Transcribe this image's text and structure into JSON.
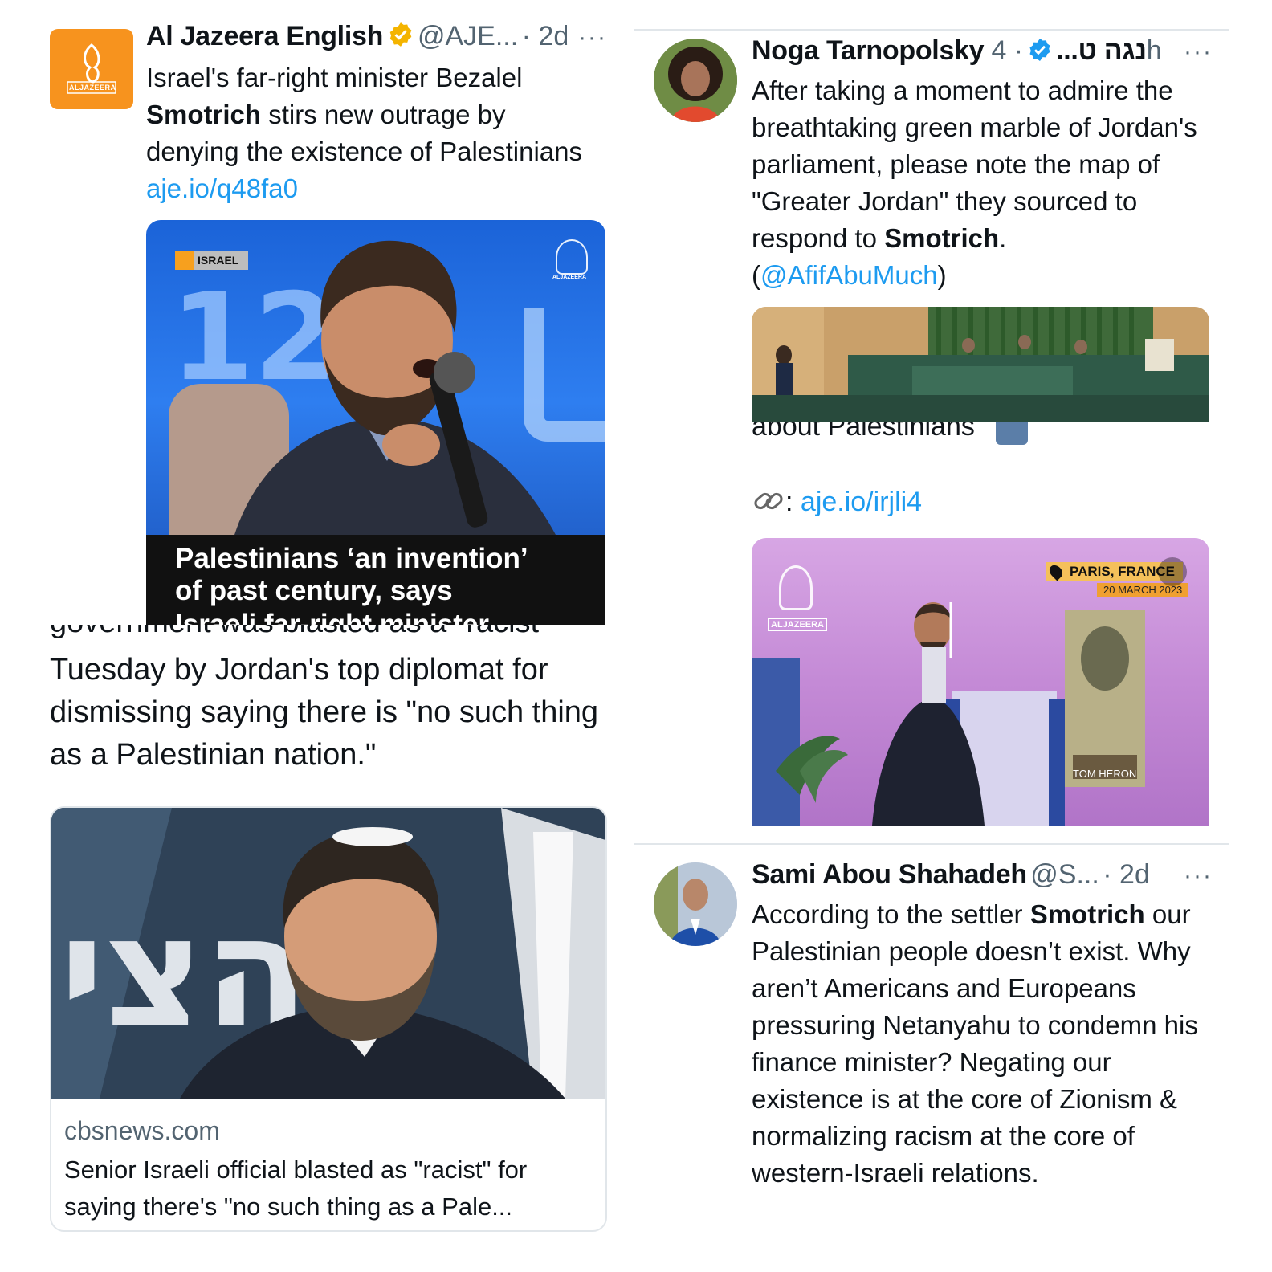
{
  "colors": {
    "link": "#1d9bf0",
    "verified_gold": "#f4b400",
    "verified_blue": "#1d9bf0",
    "aj_orange": "#f7931e"
  },
  "aj_tweet": {
    "name": "Al Jazeera English",
    "handle": "@AJE...",
    "time": "· 2d",
    "more": "···",
    "avatar_text": "ALJAZEERA",
    "text_1": "Israel's far-right minister Bezalel ",
    "text_bold": "Smotrich",
    "text_2": " stirs new outrage by denying the existence of Palestinians ",
    "link": "aje.io/q48fa0",
    "card": {
      "tag": "ISRAEL",
      "logo_text": "ALJAZEERA",
      "bg_number": "12",
      "caption_1": "Palestinians ‘an invention’",
      "caption_2": "of past century, says",
      "caption_3": "Israeli far-right minister"
    }
  },
  "cbs_post": {
    "clipped_line": "government was blasted as a \"racist\"",
    "text": "Tuesday by Jordan's top diplomat for dismissing saying there is \"no such thing as a Palestinian nation.\"",
    "card_domain": "cbsnews.com",
    "card_title": "Senior Israeli official blasted as \"racist\" for saying there's \"no such thing as a Pale..."
  },
  "noga_tweet": {
    "name": "Noga Tarnopolsky נגה ט...",
    "time": "· 4h",
    "more": "···",
    "text_1": "After taking a moment to admire the breathtaking green marble of Jordan's parliament, please note the map of \"Greater Jordan\" they sourced to respond to ",
    "text_bold": "Smotrich",
    "text_2": ".",
    "paren_open": "(",
    "mention": "@AfifAbuMuch",
    "paren_close": ")"
  },
  "aj_video": {
    "clipped_line": "about Palestinians",
    "link_prefix": ": ",
    "link": "aje.io/irjli4",
    "location": "PARIS, FRANCE",
    "date": "20 MARCH 2023",
    "logo_text": "ALJAZEERA",
    "poster_text": "TOM HERON"
  },
  "sami_tweet": {
    "name": "Sami Abou Shahadeh",
    "handle": "@S...",
    "time": "· 2d",
    "more": "···",
    "text_1": "According to the settler ",
    "text_bold": "Smotrich",
    "text_2": " our Palestinian people doesn’t exist. Why aren’t Americans and Europeans pressuring Netanyahu to condemn his finance minister? Negating our existence is at the core of Zionism & normalizing racism at the core of western-Israeli relations."
  }
}
